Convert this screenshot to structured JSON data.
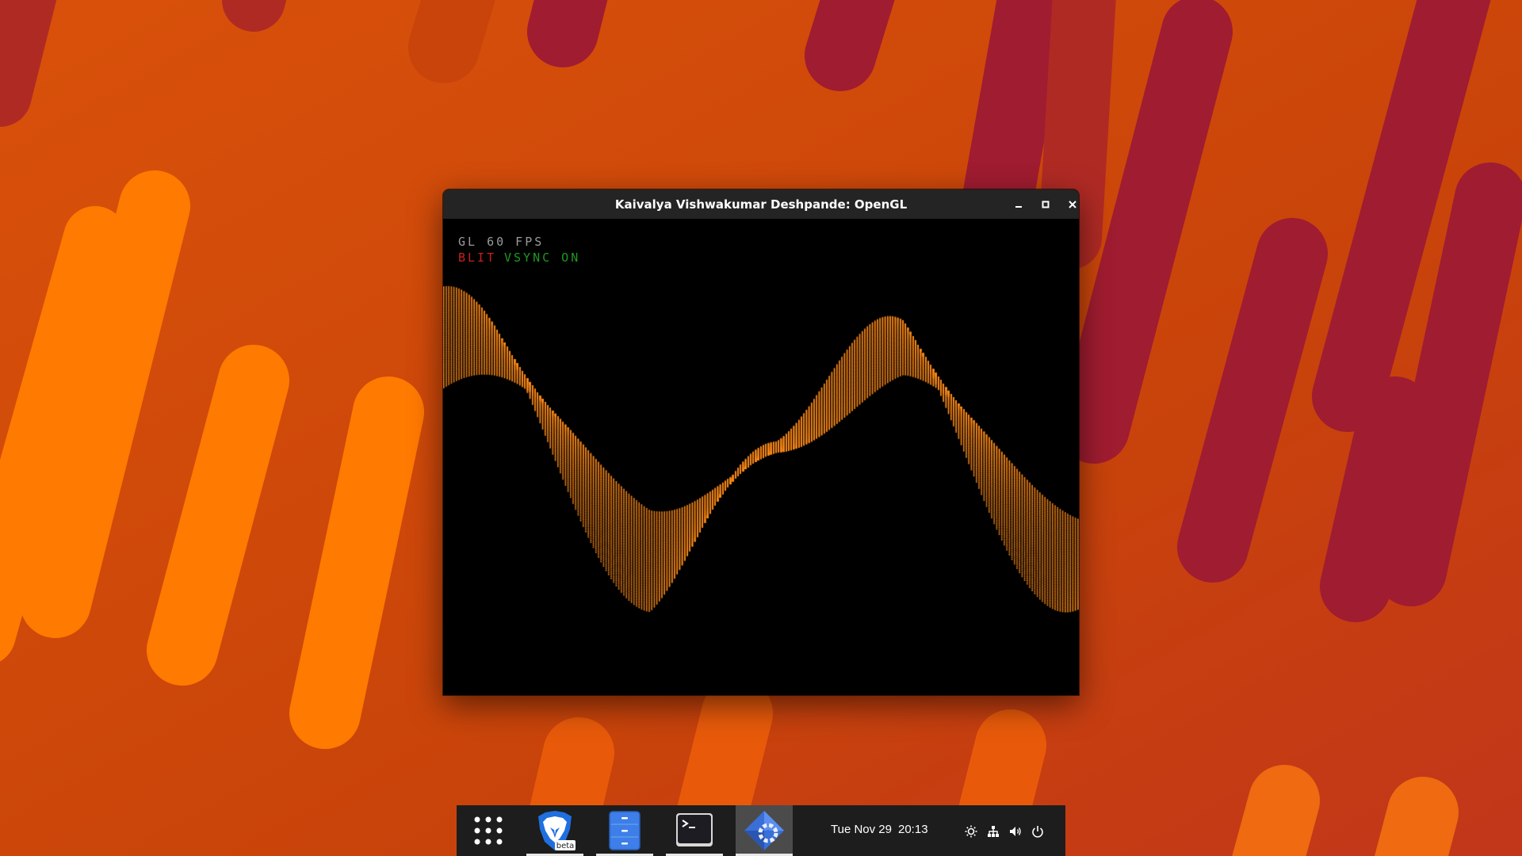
{
  "theme": {
    "wallpaper_base": "#c9440a",
    "wallpaper_light": "#ff7a00",
    "wallpaper_dark": "#a01c30",
    "titlebar": "#242424",
    "dock_bg": "#1d1d1d",
    "wave_color": "#ff8c1a"
  },
  "window": {
    "title": "Kaivalya Vishwakumar Deshpande: OpenGL",
    "controls": {
      "minimize_icon": "minimize-icon",
      "maximize_icon": "maximize-icon",
      "close_icon": "close-icon"
    }
  },
  "hud": {
    "fps": "GL 60 FPS",
    "blit": "BLIT",
    "vsync": "VSYNC ON"
  },
  "dock": {
    "apps": [
      {
        "name": "Show Applications",
        "icon": "apps-grid-icon",
        "running": false
      },
      {
        "name": "Brave Browser Beta",
        "icon": "brave-lion-icon",
        "badge": "beta",
        "running": true
      },
      {
        "name": "Files",
        "icon": "file-cabinet-icon",
        "running": true
      },
      {
        "name": "Terminal",
        "icon": "terminal-icon",
        "running": true
      },
      {
        "name": "OpenGL App",
        "icon": "gear-cube-icon",
        "running": true,
        "focused": true
      }
    ],
    "clock": {
      "date": "Tue Nov 29",
      "time": "20:13"
    },
    "tray": [
      "brightness-icon",
      "network-icon",
      "volume-icon",
      "power-icon"
    ]
  }
}
